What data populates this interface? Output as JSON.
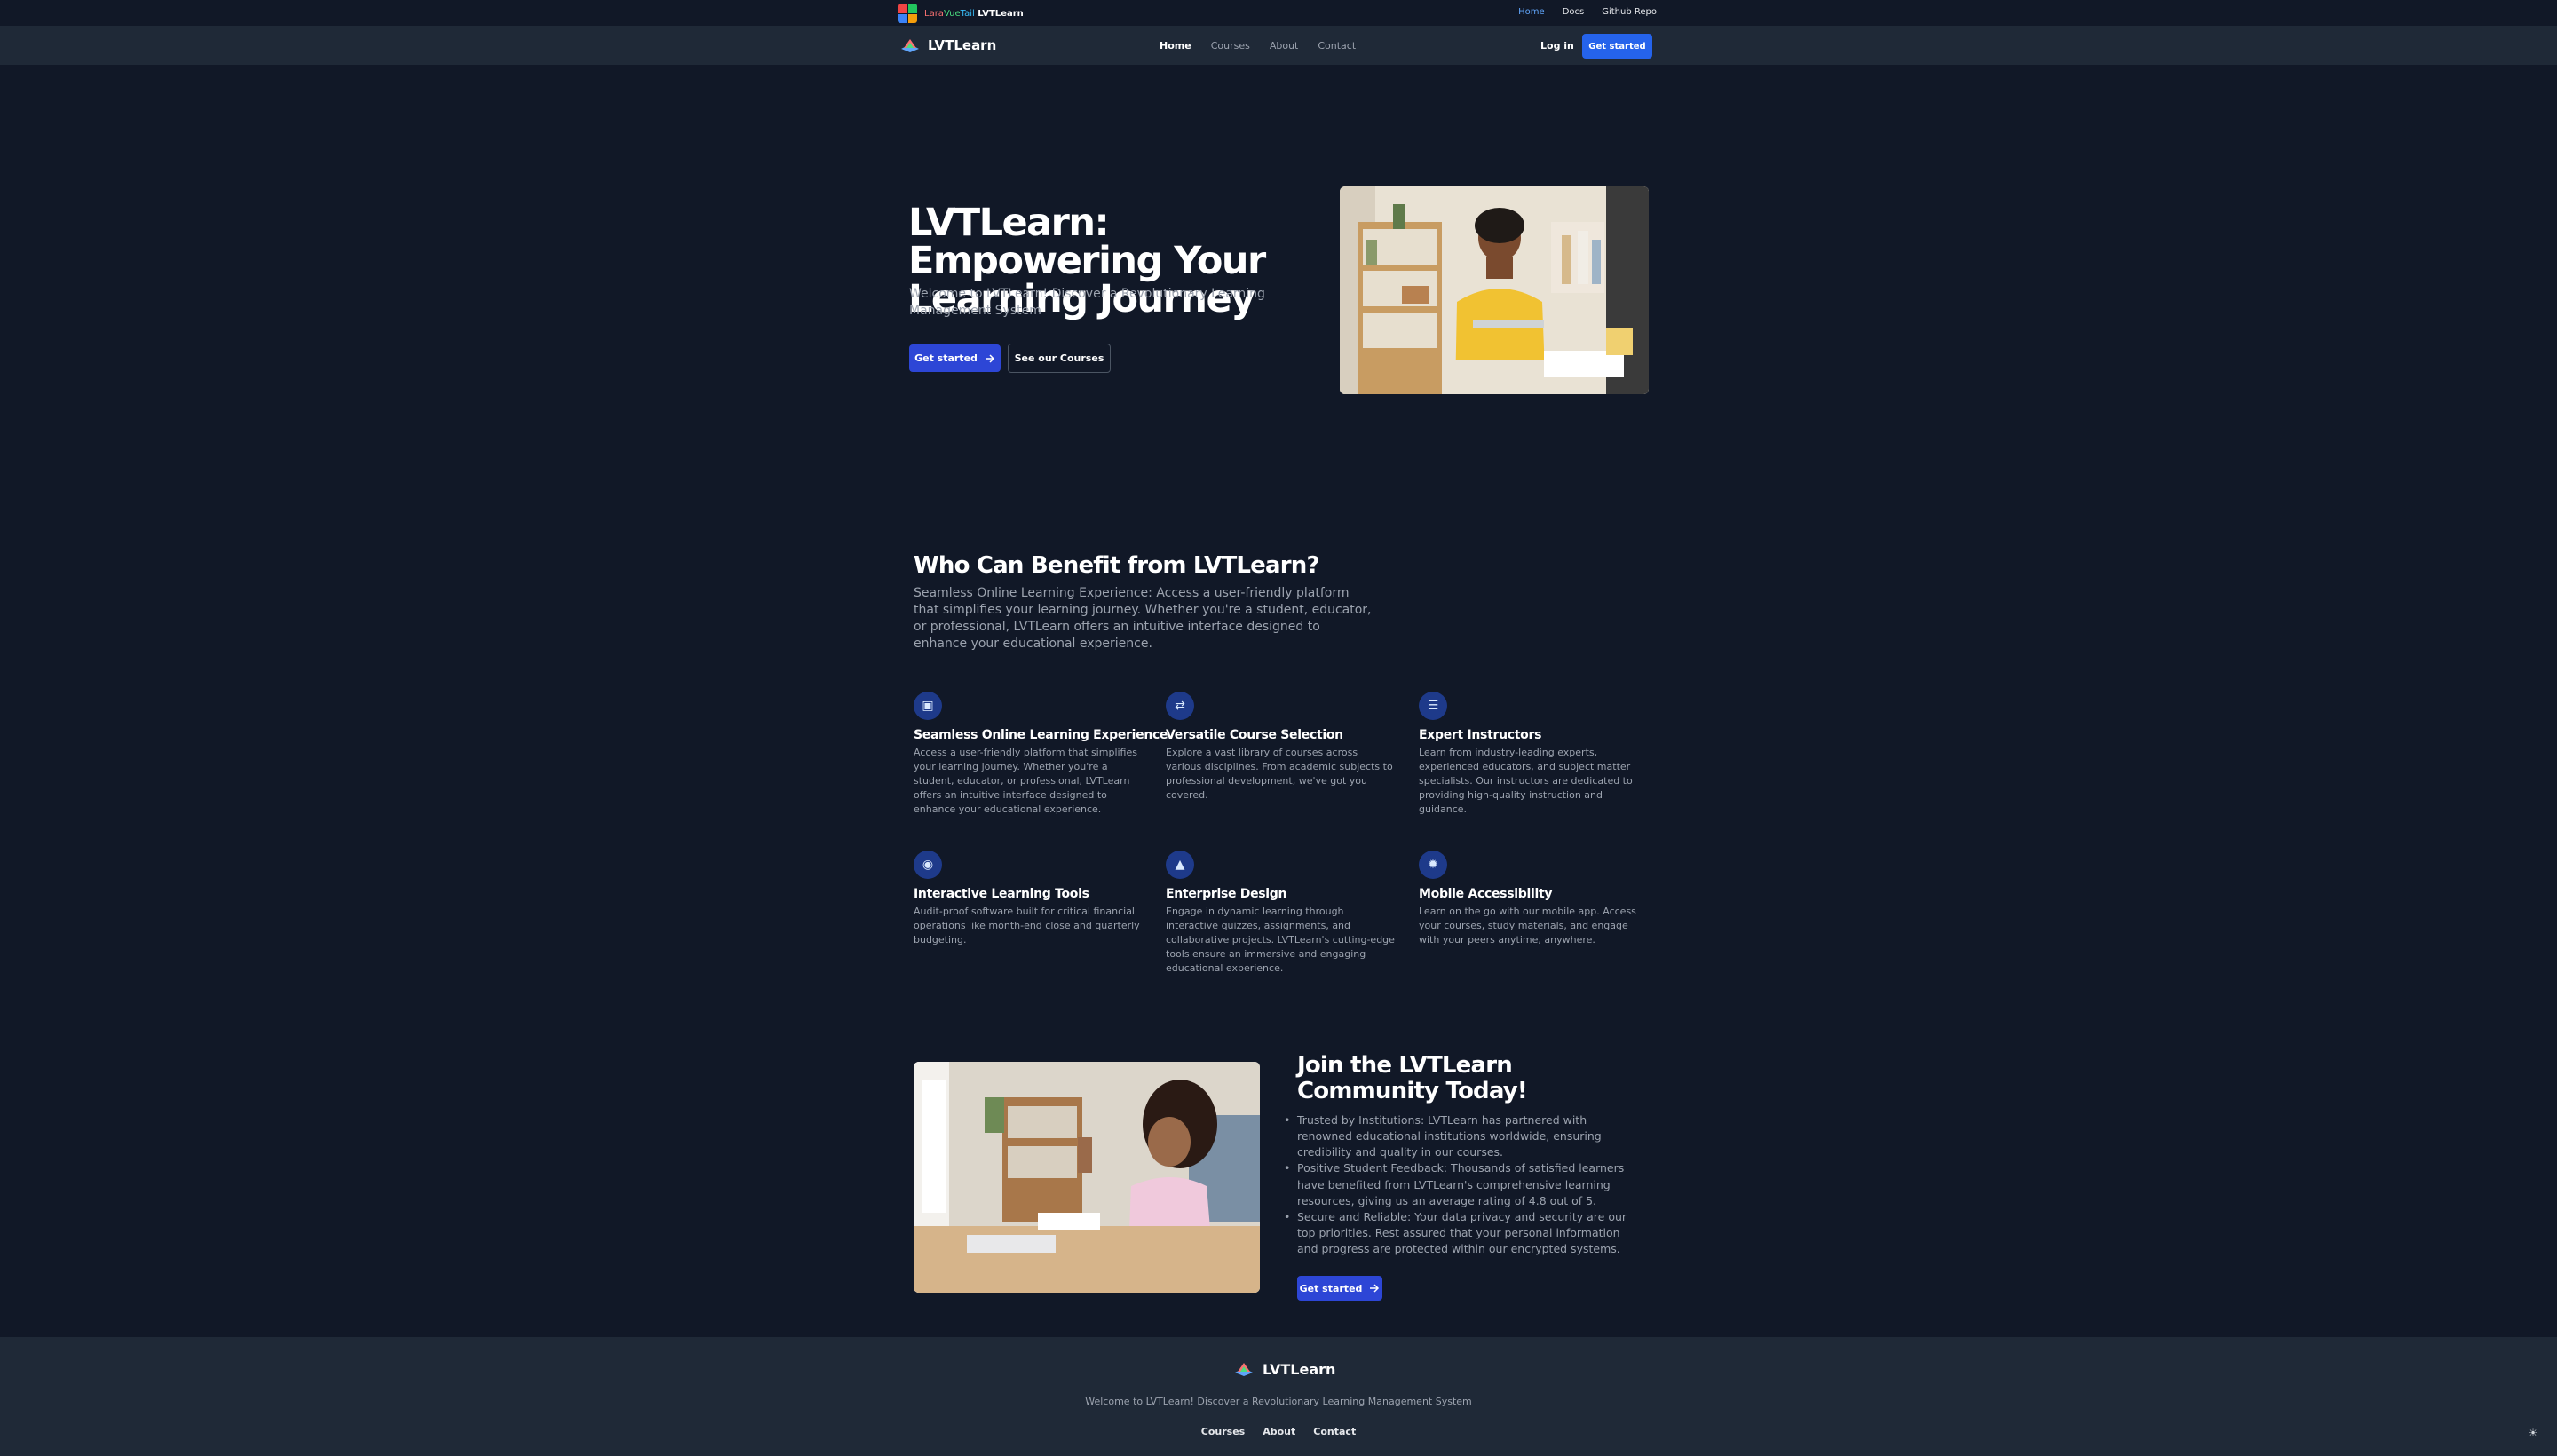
{
  "topbar": {
    "brand_lara": "Lara",
    "brand_vue": "Vue",
    "brand_tail": "Tail",
    "brand_name": "LVTLearn",
    "links": [
      "Home",
      "Docs",
      "Github Repo"
    ],
    "active_link": "Home"
  },
  "nav": {
    "brand": "LVTLearn",
    "links": [
      "Home",
      "Courses",
      "About",
      "Contact"
    ],
    "login": "Log in",
    "cta": "Get started"
  },
  "hero": {
    "title": "LVTLearn: Empowering Your Learning Journey",
    "subtitle": "Welcome to LVTLearn! Discover a Revolutionary Learning Management System",
    "primary_cta": "Get started",
    "secondary_cta": "See our Courses"
  },
  "who": {
    "title": "Who Can Benefit from LVTLearn?",
    "description": "Seamless Online Learning Experience: Access a user-friendly platform that simplifies your learning journey. Whether you're a student, educator, or professional, LVTLearn offers an intuitive interface designed to enhance your educational experience.",
    "features": [
      {
        "icon": "monitor-icon",
        "title": "Seamless Online Learning Experience",
        "body": "Access a user-friendly platform that simplifies your learning journey. Whether you're a student, educator, or professional, LVTLearn offers an intuitive interface designed to enhance your educational experience."
      },
      {
        "icon": "course-selection-icon",
        "title": "Versatile Course Selection",
        "body": "Explore a vast library of courses across various disciplines. From academic subjects to professional development, we've got you covered."
      },
      {
        "icon": "instructor-icon",
        "title": "Expert Instructors",
        "body": "Learn from industry-leading experts, experienced educators, and subject matter specialists. Our instructors are dedicated to providing high-quality instruction and guidance."
      },
      {
        "icon": "interactive-tools-icon",
        "title": "Interactive Learning Tools",
        "body": "Audit-proof software built for critical financial operations like month-end close and quarterly budgeting."
      },
      {
        "icon": "enterprise-icon",
        "title": "Enterprise Design",
        "body": "Engage in dynamic learning through interactive quizzes, assignments, and collaborative projects. LVTLearn's cutting-edge tools ensure an immersive and engaging educational experience."
      },
      {
        "icon": "gear-icon",
        "title": "Mobile Accessibility",
        "body": "Learn on the go with our mobile app. Access your courses, study materials, and engage with your peers anytime, anywhere."
      }
    ]
  },
  "join": {
    "title": "Join the LVTLearn Community Today!",
    "points": [
      "Trusted by Institutions: LVTLearn has partnered with renowned educational institutions worldwide, ensuring credibility and quality in our courses.",
      "Positive Student Feedback: Thousands of satisfied learners have benefited from LVTLearn's comprehensive learning resources, giving us an average rating of 4.8 out of 5.",
      "Secure and Reliable: Your data privacy and security are our top priorities. Rest assured that your personal information and progress are protected within our encrypted systems."
    ],
    "cta": "Get started"
  },
  "footer": {
    "brand": "LVTLearn",
    "tagline": "Welcome to LVTLearn! Discover a Revolutionary Learning Management System",
    "links": [
      "Courses",
      "About",
      "Contact"
    ]
  },
  "colors": {
    "background": "#111827",
    "nav_bg": "#1f2937",
    "accent": "#2563eb",
    "icon_circle": "#1e3a8a"
  }
}
